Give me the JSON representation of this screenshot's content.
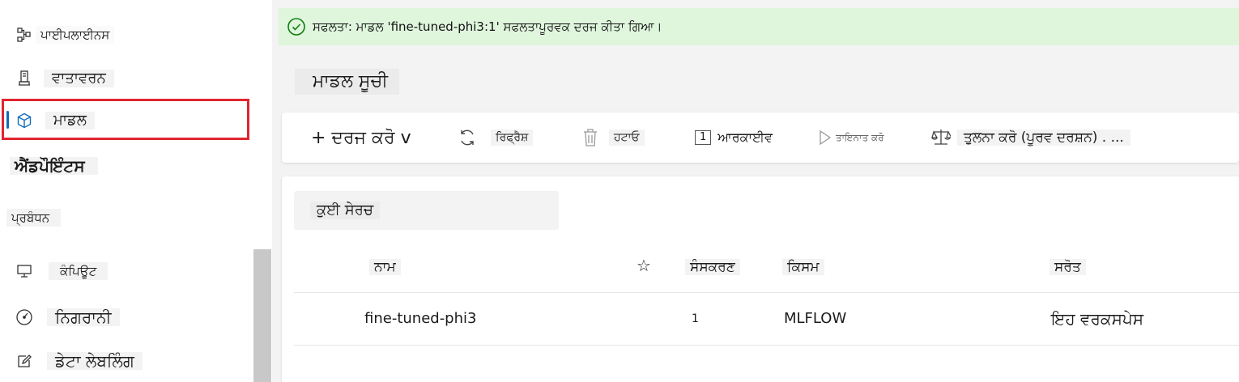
{
  "sidebar": {
    "items": [
      {
        "label": "ਪਾਈਪਲਾਈਨਸ",
        "icon": "pipeline-icon"
      },
      {
        "label": "ਵਾਤਾਵਰਨ",
        "icon": "environment-icon"
      },
      {
        "label": "ਮਾਡਲ",
        "icon": "cube-icon",
        "selected": true
      },
      {
        "label": "ਐਂਡਪੌਇੰਟਸ"
      },
      {
        "label": "ਪ੍ਰਬੰਧਨ"
      },
      {
        "label": "ਕੰਪਿਊਟ",
        "icon": "computer-icon"
      },
      {
        "label": "ਨਿਗਰਾਨੀ",
        "icon": "gauge-icon"
      },
      {
        "label": "ਡੇਟਾ ਲੇਬਲਿੰਗ",
        "icon": "edit-icon"
      }
    ]
  },
  "notification": {
    "text": "ਸਫਲਤਾ: ਮਾਡਲ 'fine-tuned-phi3:1' ਸਫਲਤਾਪੂਰਵਕ ਦਰਜ ਕੀਤਾ ਗਿਆ।",
    "color": "#dff6dd",
    "icon_color": "#107c10"
  },
  "page": {
    "title": "ਮਾਡਲ ਸੂਚੀ"
  },
  "toolbar": {
    "register": "+ ਦਰਜ ਕਰੋ v",
    "refresh": "ਰਿਫ੍ਰੈਸ਼",
    "delete": "ਹਟਾਓ",
    "archive_badge": "1",
    "archive": "ਆਰਕਾਈਵ",
    "deploy": "ਤਾਇਨਾਤ ਕਰੋ",
    "compare": "ਤੁਲਨਾ ਕਰੋ (ਪੂਰਵ ਦਰਸ਼ਨ) . ..."
  },
  "search": {
    "placeholder": "ਕੁਈ ਸੇਰਚ"
  },
  "table": {
    "headers": {
      "name": "ਨਾਮ",
      "star": "☆",
      "version": "ਸੰਸਕਰਣ",
      "type": "ਕਿਸਮ",
      "source": "ਸਰੋਤ"
    },
    "rows": [
      {
        "name": "fine-tuned-phi3",
        "version": "1",
        "type": "MLFLOW",
        "source": "ਇਹ ਵਰਕਸਪੇਸ"
      }
    ]
  },
  "colors": {
    "accent": "#0f6cbd",
    "highlight_border": "#e0262f"
  }
}
